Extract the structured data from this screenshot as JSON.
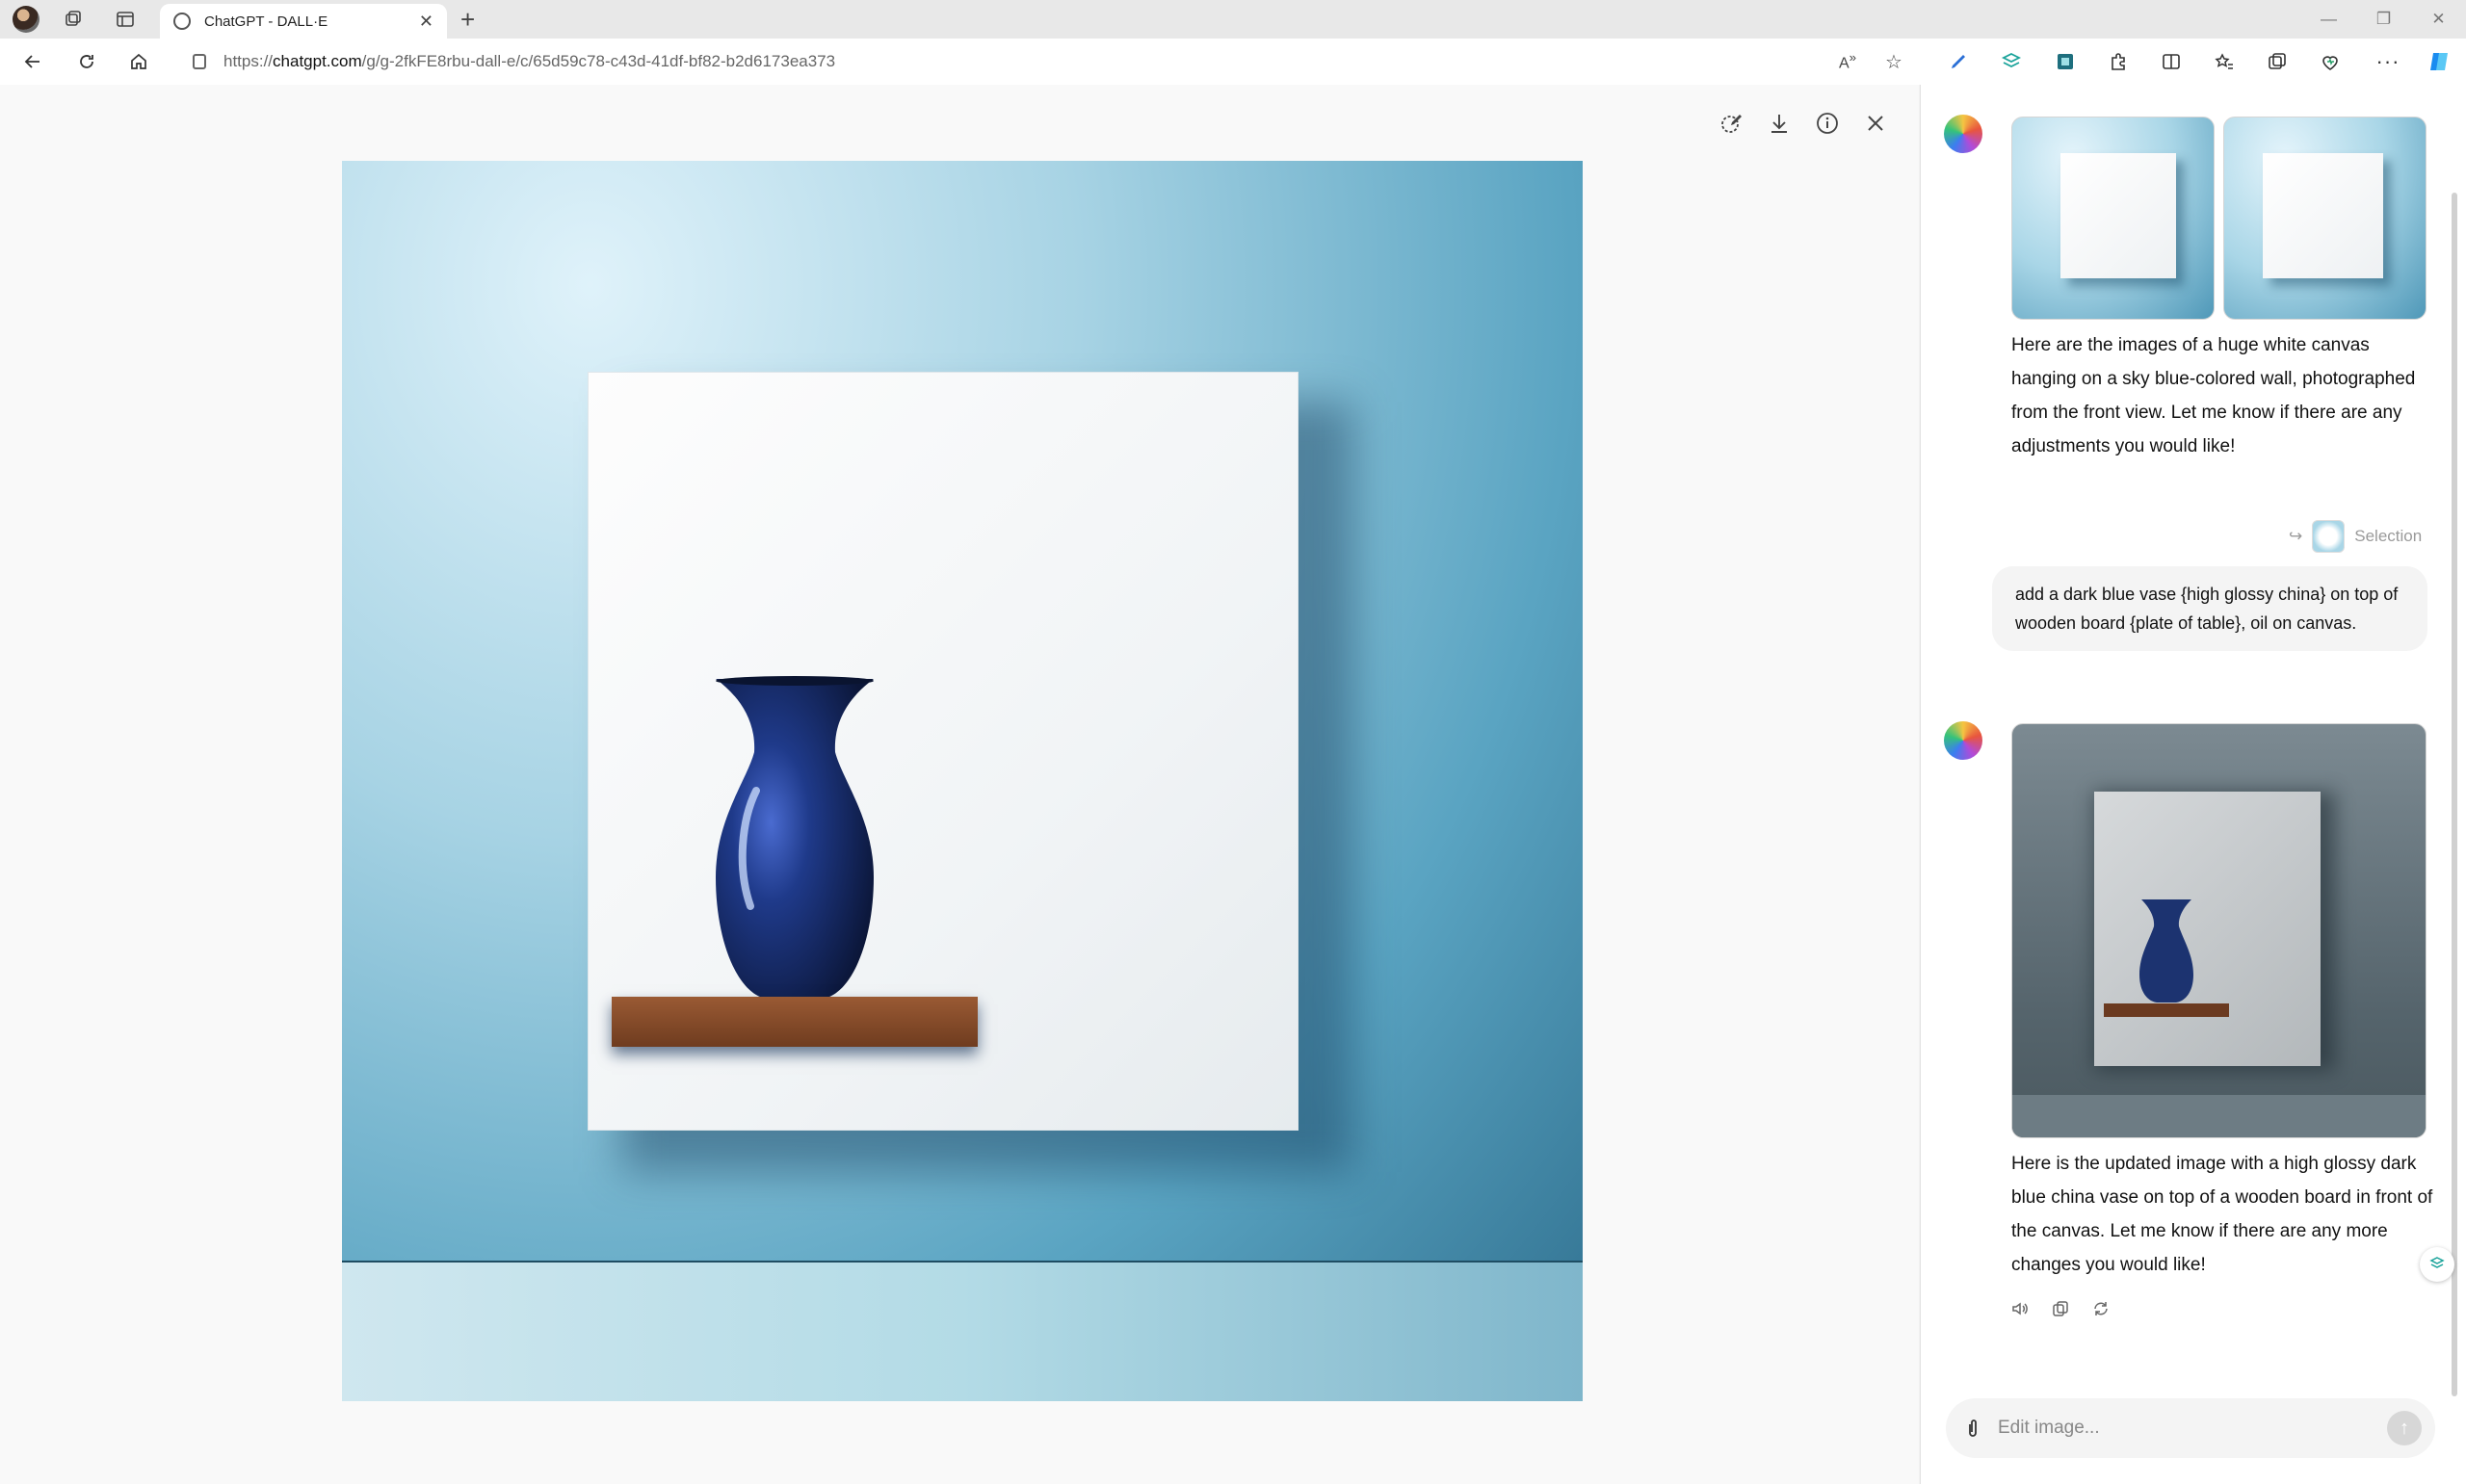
{
  "browser": {
    "tab_title": "ChatGPT - DALL·E",
    "url_prefix": "https://",
    "url_domain": "chatgpt.com",
    "url_path": "/g/g-2fkFE8rbu-dall-e/c/65d59c78-c43d-41df-bf82-b2d6173ea373"
  },
  "colors": {
    "accent_blue": "#3b7ef0",
    "canvas_wall": "#5aa4c2",
    "vase": "#1d2f6e"
  },
  "chat": {
    "assistant_message_1": "Here are the images of a huge white canvas hanging on a sky blue-colored wall, photographed from the front view. Let me know if there are any adjustments you would like!",
    "selection_label": "Selection",
    "user_message": "add a dark blue vase {high glossy china} on top of wooden board {plate of table}, oil on canvas.",
    "assistant_message_2": "Here is the updated image with a high glossy dark blue china vase on top of a wooden board in front of the canvas. Let me know if there are any more changes you would like!",
    "input_placeholder": "Edit image..."
  },
  "icons": {
    "viewer_tools": [
      "edit-selection-icon",
      "download-icon",
      "info-icon",
      "close-icon"
    ],
    "message_actions": [
      "read-aloud-icon",
      "copy-icon",
      "regenerate-icon"
    ]
  }
}
